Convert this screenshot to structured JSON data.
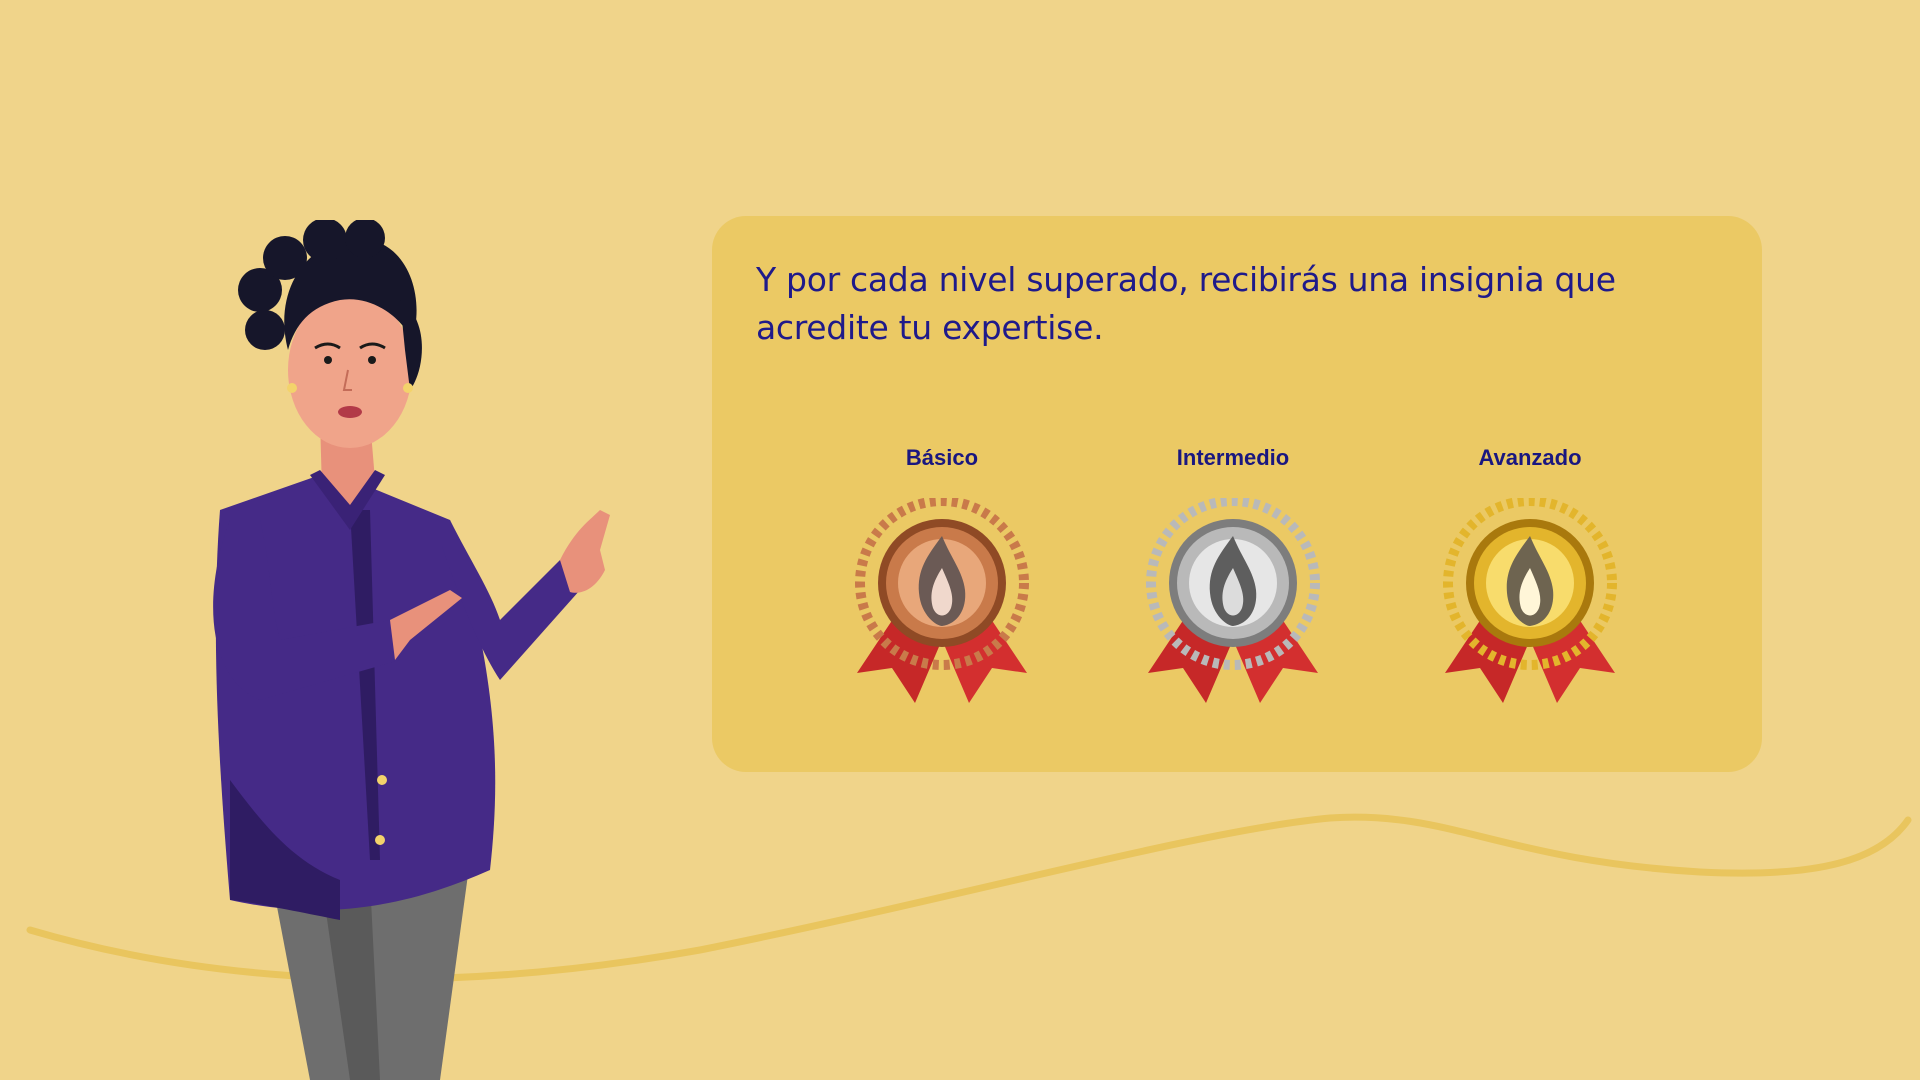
{
  "slide": {
    "message": "Y por cada nivel superado, recibirás una insignia que acredite tu expertise."
  },
  "badges": [
    {
      "label": "Básico",
      "icon": "bronze-medal-icon",
      "metal": "#c97a4a",
      "metal_light": "#e8a77a",
      "metal_dark": "#8f4a25"
    },
    {
      "label": "Intermedio",
      "icon": "silver-medal-icon",
      "metal": "#b9b9b9",
      "metal_light": "#e6e6e6",
      "metal_dark": "#7d7d7d"
    },
    {
      "label": "Avanzado",
      "icon": "gold-medal-icon",
      "metal": "#e3b52c",
      "metal_light": "#f8dc6c",
      "metal_dark": "#a9790d"
    }
  ],
  "colors": {
    "background": "#f0d48a",
    "card": "#ebc964",
    "text": "#1f1a8a",
    "ribbon": "#c62828"
  }
}
